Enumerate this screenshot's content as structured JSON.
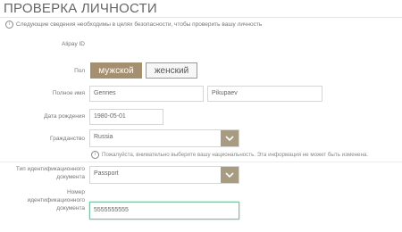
{
  "page": {
    "title": "ПРОВЕРКА ЛИЧНОСТИ",
    "info": "Следующие сведения необходимы в целях безопасности, чтобы проверить вашу личность"
  },
  "form": {
    "alipay_id_label": "Alipay ID",
    "gender_label": "Пол",
    "gender_options": [
      "мужской",
      "женский"
    ],
    "gender_selected": "мужской",
    "fullname_label": "Полное имя",
    "first_name": "Gennes",
    "last_name": "Pikupaev",
    "dob_label": "Дата рождения",
    "dob_value": "1980-05-01",
    "citizenship_label": "Гражданство",
    "citizenship_value": "Russia",
    "citizenship_notice": "Пожалуйста, внимательно выберите вашу национальность. Эта информация не может быть изменена.",
    "id_type_label_1": "Тип идентификационного",
    "id_type_label_2": "документа",
    "id_type_value": "Passport",
    "id_number_label_1": "Номер",
    "id_number_label_2": "идентификационного",
    "id_number_label_3": "документа",
    "id_number_value": "5555555555"
  },
  "colors": {
    "accent": "#a58f71",
    "select_button": "#a79b82",
    "active_border": "#7bc2a0"
  },
  "icons": [
    "info-icon",
    "chevron-down-icon"
  ]
}
